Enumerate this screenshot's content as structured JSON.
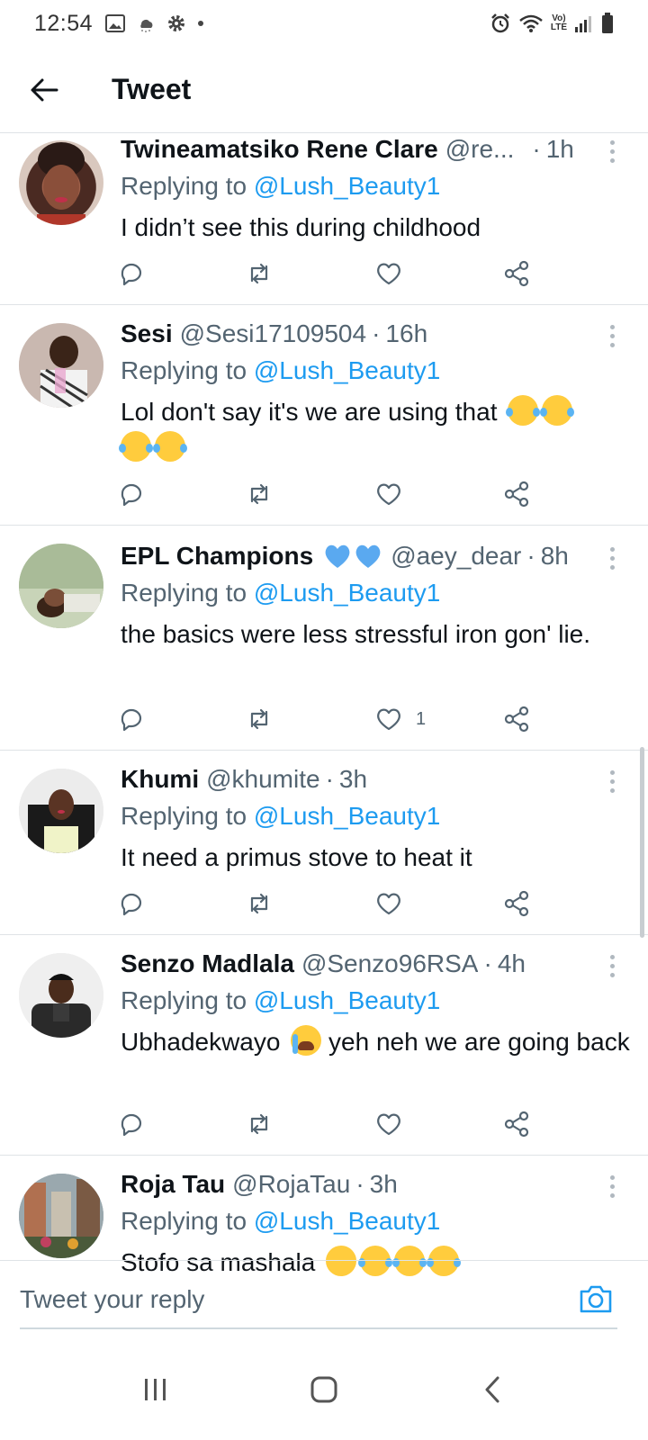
{
  "status_bar": {
    "time": "12:54",
    "left_icons": [
      "image-icon",
      "weather-icon",
      "settings-icon",
      "dot-icon"
    ],
    "right_icons": [
      "alarm-icon",
      "wifi-icon",
      "volte-icon",
      "signal-icon",
      "battery-icon"
    ],
    "volte_top": "Vo)",
    "volte_bottom": "LTE"
  },
  "header": {
    "title": "Tweet",
    "back_icon": "arrow-left-icon"
  },
  "replying_label": "Replying to",
  "tweets": [
    {
      "name": "Twineamatsiko Rene Clare",
      "handle": "@re...",
      "time": "1h",
      "mention": "@Lush_Beauty1",
      "text": "I didn’t see this during childhood",
      "likes": ""
    },
    {
      "name": "Sesi",
      "handle": "@Sesi17109504",
      "time": "16h",
      "mention": "@Lush_Beauty1",
      "text": "Lol don't say it's we are using that",
      "likes": ""
    },
    {
      "name": "EPL Champions",
      "handle": "@aey_dear",
      "time": "8h",
      "mention": "@Lush_Beauty1",
      "text": "the basics were less stressful iron gon' lie.",
      "likes": "1"
    },
    {
      "name": "Khumi",
      "handle": "@khumite",
      "time": "3h",
      "mention": "@Lush_Beauty1",
      "text": "It need a primus stove to heat it",
      "likes": ""
    },
    {
      "name": "Senzo Madlala",
      "handle": "@Senzo96RSA",
      "time": "4h",
      "mention": "@Lush_Beauty1",
      "text_before": "Ubhadekwayo",
      "text_after": "yeh neh we are going back",
      "likes": ""
    },
    {
      "name": "Roja Tau",
      "handle": "@RojaTau",
      "time": "3h",
      "mention": "@Lush_Beauty1",
      "text": "Stofo sa mashala",
      "likes": ""
    }
  ],
  "reply_bar": {
    "placeholder": "Tweet your reply",
    "camera_icon": "camera-icon"
  },
  "nav_bar": {
    "icons": [
      "recent-apps-icon",
      "home-icon",
      "back-icon"
    ]
  },
  "colors": {
    "accent": "#1d9bf0",
    "secondary_text": "#536471",
    "divider": "#dfe3e6"
  }
}
